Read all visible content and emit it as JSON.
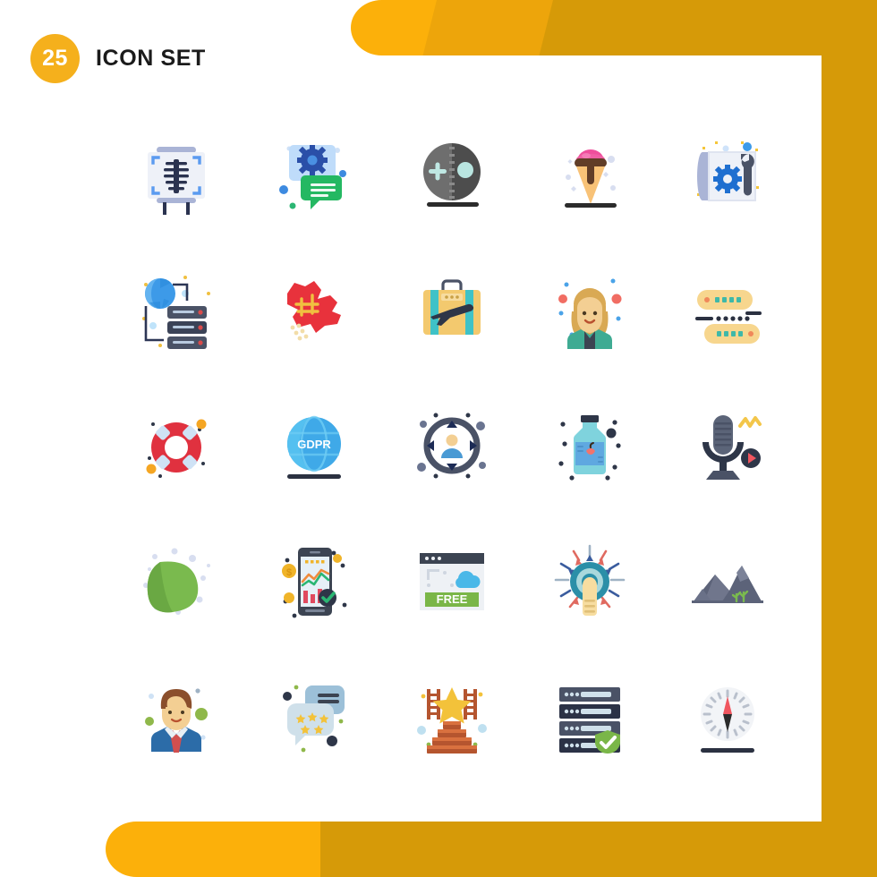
{
  "header": {
    "count": "25",
    "title": "ICON SET",
    "badge_color": "#F5B01C"
  },
  "theme": {
    "bright": "#FCB00A",
    "mid": "#EDA50B",
    "dark": "#D69A08",
    "page_background": "#FFFFFF"
  },
  "grid": {
    "columns": 5,
    "rows": 5,
    "total": 25
  },
  "icons": [
    {
      "name": "xray-scan-board-icon",
      "label": "X-Ray Scan Board"
    },
    {
      "name": "chat-gear-settings-icon",
      "label": "Chat Settings"
    },
    {
      "name": "zoom-in-sphere-icon",
      "label": "Zoom In Lens"
    },
    {
      "name": "ice-cream-cone-icon",
      "label": "Ice Cream Cone"
    },
    {
      "name": "blueprint-gear-wrench-icon",
      "label": "Blueprint Settings"
    },
    {
      "name": "global-server-network-icon",
      "label": "Global Server Network"
    },
    {
      "name": "canada-map-icon",
      "label": "Canada Map"
    },
    {
      "name": "travel-suitcase-plane-icon",
      "label": "Travel Suitcase"
    },
    {
      "name": "woman-avatar-icon",
      "label": "Woman Avatar"
    },
    {
      "name": "server-chat-bubbles-icon",
      "label": "Data Exchange"
    },
    {
      "name": "lifebuoy-support-icon",
      "label": "Lifebuoy Support"
    },
    {
      "name": "gdpr-globe-icon",
      "label": "GDPR Globe"
    },
    {
      "name": "user-targeting-icon",
      "label": "User Targeting"
    },
    {
      "name": "apple-juice-bottle-icon",
      "label": "Juice Bottle"
    },
    {
      "name": "podcast-microphone-icon",
      "label": "Podcast Microphone"
    },
    {
      "name": "green-leaf-icon",
      "label": "Green Leaf"
    },
    {
      "name": "mobile-analytics-icon",
      "label": "Mobile Analytics"
    },
    {
      "name": "free-browser-window-icon",
      "label": "Free Web Page"
    },
    {
      "name": "touch-target-finger-icon",
      "label": "Touch Target"
    },
    {
      "name": "mountain-landscape-icon",
      "label": "Mountain Landscape"
    },
    {
      "name": "businessman-avatar-icon",
      "label": "Businessman Avatar"
    },
    {
      "name": "rating-feedback-chat-icon",
      "label": "Rating Feedback"
    },
    {
      "name": "success-stairs-star-icon",
      "label": "Success Stairs"
    },
    {
      "name": "secure-server-shield-icon",
      "label": "Secure Server"
    },
    {
      "name": "compass-icon",
      "label": "Compass"
    }
  ],
  "icon_text": {
    "gdpr": "GDPR",
    "free": "FREE"
  }
}
